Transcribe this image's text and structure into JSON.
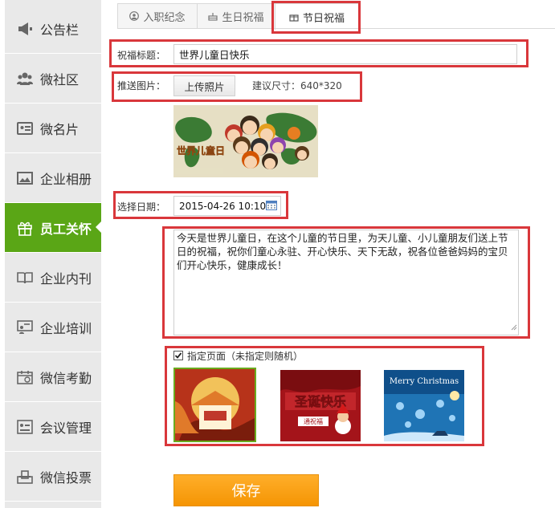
{
  "sidebar": {
    "items": [
      {
        "label": "公告栏",
        "icon": "megaphone-icon"
      },
      {
        "label": "微社区",
        "icon": "people-icon"
      },
      {
        "label": "微名片",
        "icon": "card-icon"
      },
      {
        "label": "企业相册",
        "icon": "image-icon"
      },
      {
        "label": "员工关怀",
        "icon": "gift-icon",
        "active": true
      },
      {
        "label": "企业内刊",
        "icon": "book-icon"
      },
      {
        "label": "企业培训",
        "icon": "training-icon"
      },
      {
        "label": "微信考勤",
        "icon": "calendar-icon"
      },
      {
        "label": "会议管理",
        "icon": "meeting-icon"
      },
      {
        "label": "微信投票",
        "icon": "vote-icon"
      }
    ]
  },
  "tabs": [
    {
      "label": "入职纪念"
    },
    {
      "label": "生日祝福"
    },
    {
      "label": "节日祝福",
      "active": true
    }
  ],
  "form": {
    "title_label": "祝福标题：",
    "title_value": "世界儿童日快乐",
    "image_label": "推送图片：",
    "upload_button": "上传照片",
    "size_hint": "建议尺寸：640*320",
    "image_caption": "世界儿童日",
    "date_label": "选择日期：",
    "date_value": "2015-04-26 10:10",
    "message": "今天是世界儿童日，在这个儿童的节日里，为天儿童、小儿童朋友们送上节日的祝福，祝你们童心永驻、开心快乐、天下无敌，祝各位爸爸妈妈的宝贝们开心快乐，健康成长！",
    "page_checkbox_label": "指定页面（未指定则随机）",
    "page_checkbox_checked": true,
    "thumb2_caption": "通祝福",
    "thumb3_caption": "Merry Christmas",
    "save_button": "保存"
  },
  "colors": {
    "sidebar_active": "#5aa616",
    "highlight_border": "#d9373b",
    "save_button": "#f59a0c"
  }
}
